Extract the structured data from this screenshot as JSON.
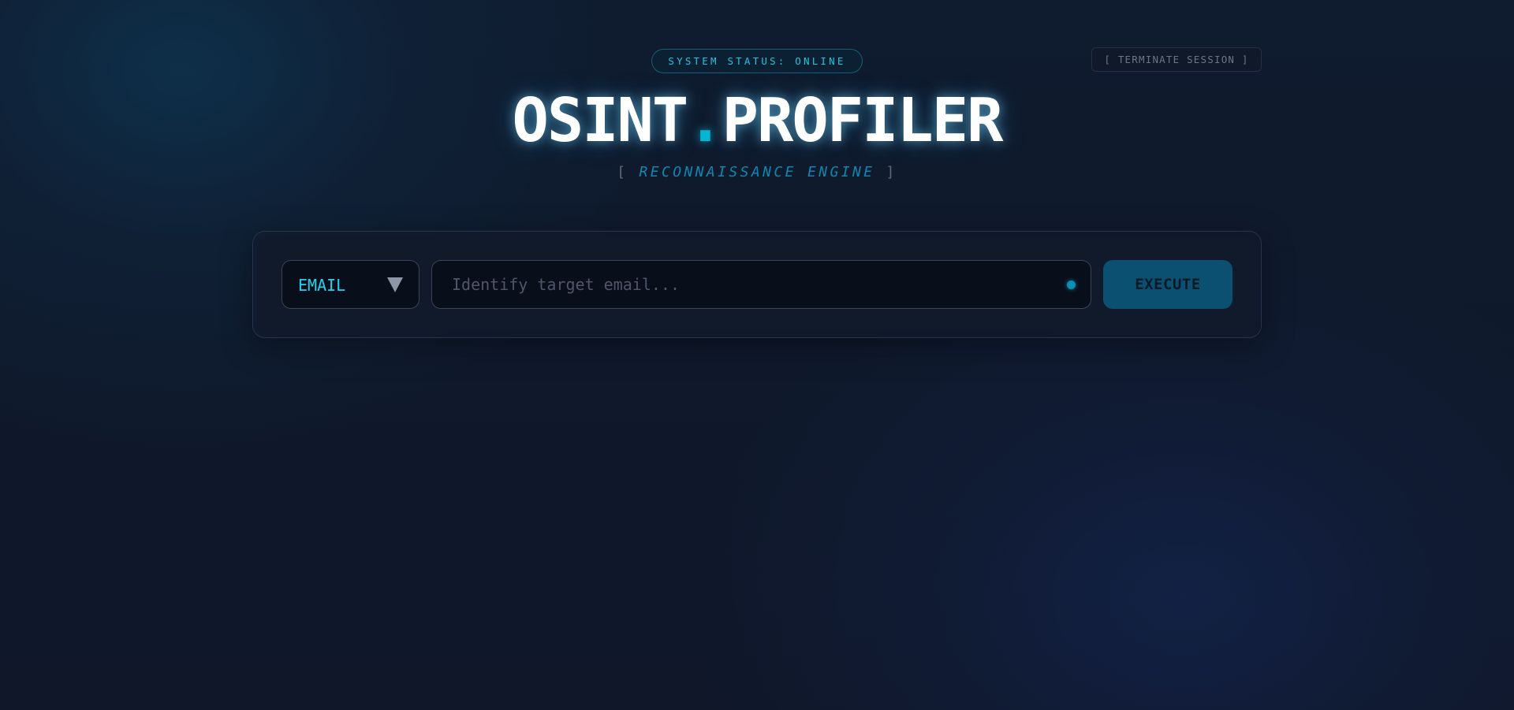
{
  "header": {
    "status_badge": "SYSTEM STATUS: ONLINE",
    "terminate_label": "[ TERMINATE SESSION ]",
    "title_left": "OSINT",
    "title_dot": ".",
    "title_right": "PROFILER",
    "subtitle_open": "[",
    "subtitle_text": "RECONNAISSANCE ENGINE",
    "subtitle_close": "]"
  },
  "search": {
    "type_selected": "EMAIL",
    "input_value": "",
    "input_placeholder": "Identify target email...",
    "execute_label": "EXECUTE"
  },
  "icons": {
    "dropdown": "chevron-down-icon",
    "status": "status-dot-icon"
  },
  "colors": {
    "accent": "#22d3ee",
    "accent_dark": "#06b6d4",
    "button_bg": "#0b5070",
    "background": "#0f1729"
  }
}
